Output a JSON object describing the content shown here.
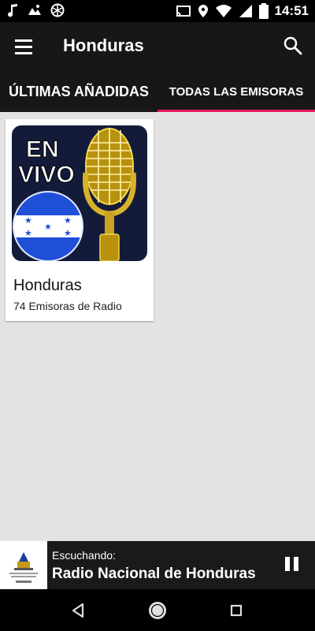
{
  "status_bar": {
    "time": "14:51",
    "icons_left": [
      "music-note-icon",
      "photos-icon",
      "aperture-icon"
    ],
    "icons_right": [
      "cast-icon",
      "location-icon",
      "wifi-icon",
      "signal-icon",
      "battery-icon"
    ]
  },
  "app_bar": {
    "title": "Honduras",
    "menu_icon": "menu-icon",
    "search_icon": "search-icon"
  },
  "tabs": [
    {
      "label": "ÚLTIMAS AÑADIDAS",
      "selected": false
    },
    {
      "label": "TODAS LAS EMISORAS",
      "selected": true
    }
  ],
  "accent_color": "#e8195a",
  "stations": [
    {
      "name": "Honduras",
      "count": "74 Emisoras de Radio",
      "badge": [
        "EN",
        "VIVO"
      ]
    }
  ],
  "player": {
    "label": "Escuchando:",
    "station": "Radio Nacional de Honduras",
    "pause_icon": "pause-icon"
  },
  "nav_bar": {
    "buttons": [
      "back-icon",
      "home-icon",
      "recents-icon"
    ]
  }
}
